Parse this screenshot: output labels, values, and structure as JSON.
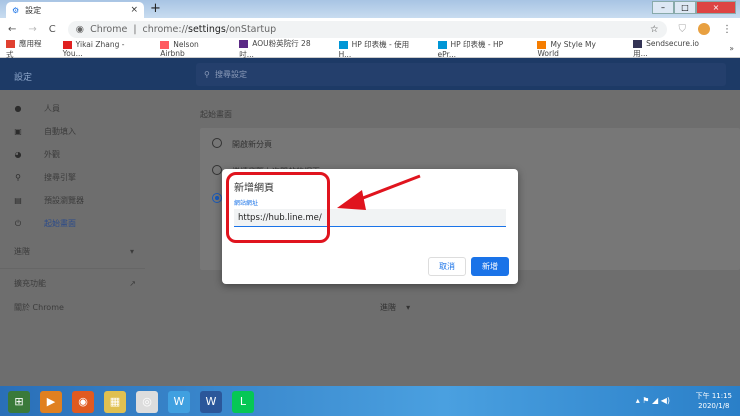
{
  "browser": {
    "tab_title": "設定",
    "tab_close": "×",
    "new_tab": "+",
    "back": "←",
    "forward": "→",
    "reload": "C",
    "omnibox_site": "Chrome",
    "omnibox_url_prefix": "chrome://",
    "omnibox_url_bold": "settings",
    "omnibox_url_suffix": "/onStartup",
    "star": "☆",
    "menu": "⋮",
    "window": {
      "minimize": "–",
      "maximize": "□",
      "close": "×"
    }
  },
  "bookmarks": [
    {
      "label": "應用程式",
      "color": "#e04030"
    },
    {
      "label": "Yikai Zhang - You...",
      "color": "#e02020"
    },
    {
      "label": "Nelson Airbnb",
      "color": "#ff5a60"
    },
    {
      "label": "AOU粉英院行 28吋...",
      "color": "#5b2a86"
    },
    {
      "label": "HP 印表機 - 使用 H...",
      "color": "#0096d6"
    },
    {
      "label": "HP 印表機 - HP ePr...",
      "color": "#0096d6"
    },
    {
      "label": "My Style My World",
      "color": "#f57d00"
    },
    {
      "label": "Sendsecure.io 用...",
      "color": "#335"
    }
  ],
  "bookmarks_more": "»",
  "settings": {
    "title": "設定",
    "search_placeholder": "搜尋設定",
    "sidebar": [
      {
        "label": "人員",
        "icon": "person-icon",
        "glyph": "●"
      },
      {
        "label": "自動填入",
        "icon": "clipboard-icon",
        "glyph": "▣"
      },
      {
        "label": "外觀",
        "icon": "palette-icon",
        "glyph": "◕"
      },
      {
        "label": "搜尋引擎",
        "icon": "search-icon",
        "glyph": "⚲"
      },
      {
        "label": "預設瀏覽器",
        "icon": "browser-icon",
        "glyph": "▤"
      },
      {
        "label": "起始畫面",
        "icon": "power-icon",
        "glyph": "⏻"
      }
    ],
    "advanced": "進階",
    "advanced_arrow": "▾",
    "extensions": "擴充功能",
    "extensions_icon": "↗",
    "about": "關於 Chrome",
    "startup_heading": "起始畫面",
    "startup_options": [
      "開啟新分頁",
      "繼續瀏覽上次開啟的網頁"
    ],
    "bottom_advanced": "進階"
  },
  "dialog": {
    "title": "新增網頁",
    "field_label": "網站網址",
    "field_value": "https://hub.line.me/",
    "cancel": "取消",
    "add": "新增"
  },
  "annotation_color": "#e0141e",
  "taskbar": {
    "apps": [
      "start",
      "media",
      "firefox",
      "explorer",
      "chrome",
      "writer",
      "word",
      "line"
    ],
    "time": "下午 11:15",
    "date": "2020/1/8"
  }
}
